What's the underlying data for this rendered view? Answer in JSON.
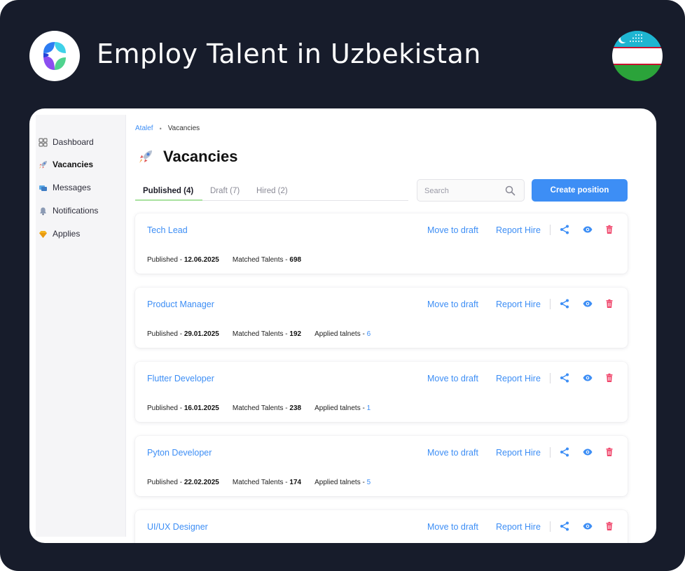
{
  "banner": {
    "title": "Employ Talent in Uzbekistan",
    "logo_icon": "atalef-logo-icon",
    "flag_icon": "uzbekistan-flag-icon"
  },
  "sidebar": {
    "items": [
      {
        "label": "Dashboard",
        "icon": "dashboard-icon"
      },
      {
        "label": "Vacancies",
        "icon": "rocket-icon"
      },
      {
        "label": "Messages",
        "icon": "messages-icon"
      },
      {
        "label": "Notifications",
        "icon": "bell-icon"
      },
      {
        "label": "Applies",
        "icon": "gem-icon"
      }
    ]
  },
  "breadcrumb": {
    "root": "Atalef",
    "separator": "•",
    "current": "Vacancies"
  },
  "page": {
    "title": "Vacancies",
    "icon": "rocket-icon"
  },
  "tabs": [
    {
      "label": "Published (4)"
    },
    {
      "label": "Draft (7)"
    },
    {
      "label": "Hired (2)"
    }
  ],
  "search": {
    "placeholder": "Search"
  },
  "create_button": {
    "label": "Create position"
  },
  "card_labels": {
    "move_to_draft": "Move to draft",
    "report_hire": "Report Hire",
    "published": "Published - ",
    "matched": "Matched Talents - ",
    "applied": "Applied talnets - "
  },
  "vacancies": [
    {
      "title": "Tech Lead",
      "published": "12.06.2025",
      "matched": "698",
      "applied": ""
    },
    {
      "title": "Product Manager",
      "published": "29.01.2025",
      "matched": "192",
      "applied": "6"
    },
    {
      "title": "Flutter Developer",
      "published": "16.01.2025",
      "matched": "238",
      "applied": "1"
    },
    {
      "title": "Pyton Developer",
      "published": "22.02.2025",
      "matched": "174",
      "applied": "5"
    },
    {
      "title": "UI/UX Designer",
      "published": "",
      "matched": "",
      "applied": ""
    }
  ],
  "colors": {
    "frame_bg": "#171c2b",
    "accent": "#3d8ef5",
    "delete": "#f0456a",
    "tab_underline": "#a9e2a0"
  }
}
